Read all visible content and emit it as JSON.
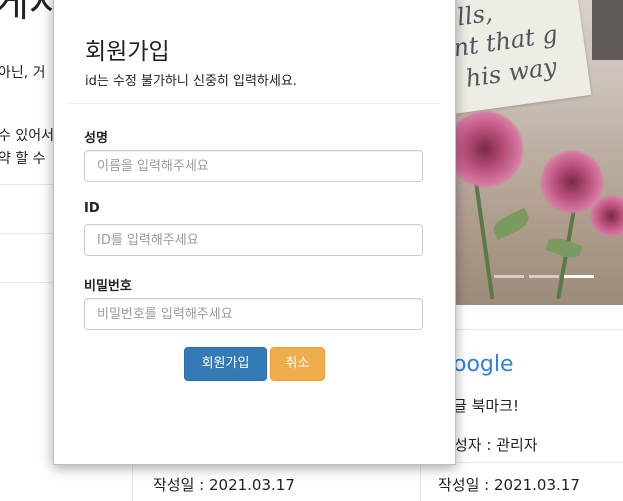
{
  "background": {
    "heading": "게시",
    "lines": [
      "아닌, 거",
      "수 있어서",
      "약 할 수"
    ],
    "card": {
      "link_text": "oogle",
      "desc": "글 북마크!",
      "author": "성자 : 관리자",
      "date_right": "작성일 : 2021.03.17",
      "date_left": "작성일 : 2021.03.17"
    },
    "photo_scribbles": [
      "lls,",
      "nt that g",
      "his way"
    ]
  },
  "modal": {
    "title": "회원가입",
    "subtitle": "id는 수정 불가하니 신중히 입력하세요.",
    "fields": {
      "name": {
        "label": "성명",
        "placeholder": "이름을 입력해주세요",
        "value": ""
      },
      "id": {
        "label": "ID",
        "placeholder": "ID를 입력해주세요",
        "value": ""
      },
      "password": {
        "label": "비밀번호",
        "placeholder": "비밀번호를 입력해주세요",
        "value": ""
      }
    },
    "buttons": {
      "submit": "회원가입",
      "cancel": "취소"
    }
  },
  "colors": {
    "primary": "#337ab7",
    "warning": "#f0ad4e",
    "link": "#2f7de1"
  }
}
